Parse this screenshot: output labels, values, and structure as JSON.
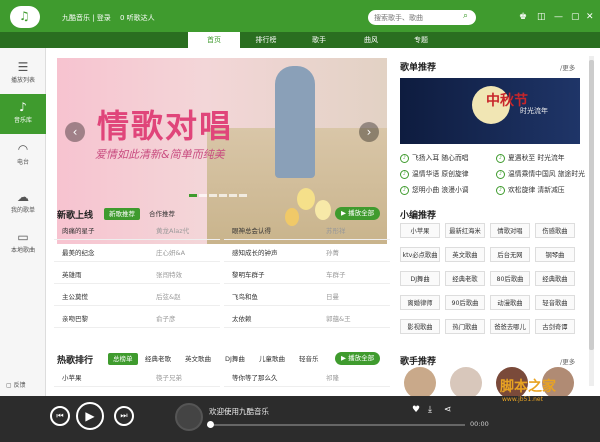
{
  "app": {
    "user_label": "九酷音乐 | 登录",
    "listening": "0 听歌达人"
  },
  "search": {
    "placeholder": "搜索歌手、歌曲"
  },
  "nav": {
    "tabs": [
      "首页",
      "排行榜",
      "歌手",
      "曲风",
      "专题"
    ],
    "active": "首页"
  },
  "sidebar": {
    "items": [
      {
        "label": "播放列表",
        "icon": "list-icon"
      },
      {
        "label": "音乐库",
        "icon": "music-note-icon"
      },
      {
        "label": "电台",
        "icon": "wifi-icon"
      },
      {
        "label": "我的歌单",
        "icon": "cloud-icon"
      },
      {
        "label": "本地歌曲",
        "icon": "monitor-icon"
      }
    ],
    "feedback": "反馈"
  },
  "banner": {
    "title": "情歌对唱",
    "subtitle": "爱情如此清新&简单而纯美",
    "prev": "‹",
    "next": "›"
  },
  "new_songs": {
    "title": "新歌上线",
    "tabs": [
      "新歌推荐",
      "合作推荐"
    ],
    "play_all": "播放全部",
    "rows": [
      [
        "肉痛的星子",
        "黄龙Alaz代"
      ],
      [
        "眼神总会认得",
        "苏彤祥"
      ],
      [
        "最美的纪念",
        "庄心妍&A"
      ],
      [
        "感知成长的钟声",
        "孙菁"
      ],
      [
        "英雄雨",
        "张闯特效"
      ],
      [
        "黎明车群子",
        "车群子"
      ],
      [
        "主公莫慌",
        "后弦&赵"
      ],
      [
        "飞鸟和鱼",
        "日曼"
      ],
      [
        "亲吻巴黎",
        "俞子彦"
      ],
      [
        "太依赖",
        "郭蕴&王"
      ]
    ]
  },
  "hot_songs": {
    "title": "热歌排行",
    "tabs": [
      "总榜单",
      "经典老歌",
      "英文歌曲",
      "DJ舞曲",
      "儿童歌曲",
      "轻音乐"
    ],
    "play_all": "播放全部",
    "rows": [
      [
        "小苹果",
        "筷子兄弟"
      ],
      [
        "等你等了那么久",
        "祁隆"
      ]
    ]
  },
  "playlists": {
    "title": "歌单推荐",
    "more": "更多",
    "featured_title": "中秋节",
    "featured_sub": "时光流年",
    "items": [
      "飞扬入耳",
      "随心而唱",
      "夏遇秋至",
      "时光流年",
      "温情华语",
      "原创旋律",
      "温情乘情中国风",
      "旅途时光",
      "您明小曲",
      "浪漫小调",
      "欢松旋律",
      "清新减压"
    ]
  },
  "tags": {
    "title": "小编推荐",
    "items": [
      "小苹果",
      "最新红海米",
      "情歌对唱",
      "伤感歌曲",
      "ktv必点歌曲",
      "英文歌曲",
      "后台无网",
      "钢琴曲",
      "DJ舞曲",
      "经典老歌",
      "80后歌曲",
      "经典歌曲",
      "离婚律师",
      "90后歌曲",
      "动漫歌曲",
      "轻音歌曲",
      "影视歌曲",
      "热门歌曲",
      "爸爸去哪儿",
      "古剑奇谭"
    ]
  },
  "singers": {
    "title": "歌手推荐",
    "more": "更多"
  },
  "player": {
    "now_playing": "欢迎使用九酷音乐",
    "time": "00:00",
    "progress": 0.0
  },
  "watermark": {
    "text": "脚本之家",
    "sub": "www.jb51.net"
  },
  "colors": {
    "accent": "#3f9b2e",
    "nav_bg": "#2a6e20",
    "player_bg": "#2c2c2c"
  }
}
